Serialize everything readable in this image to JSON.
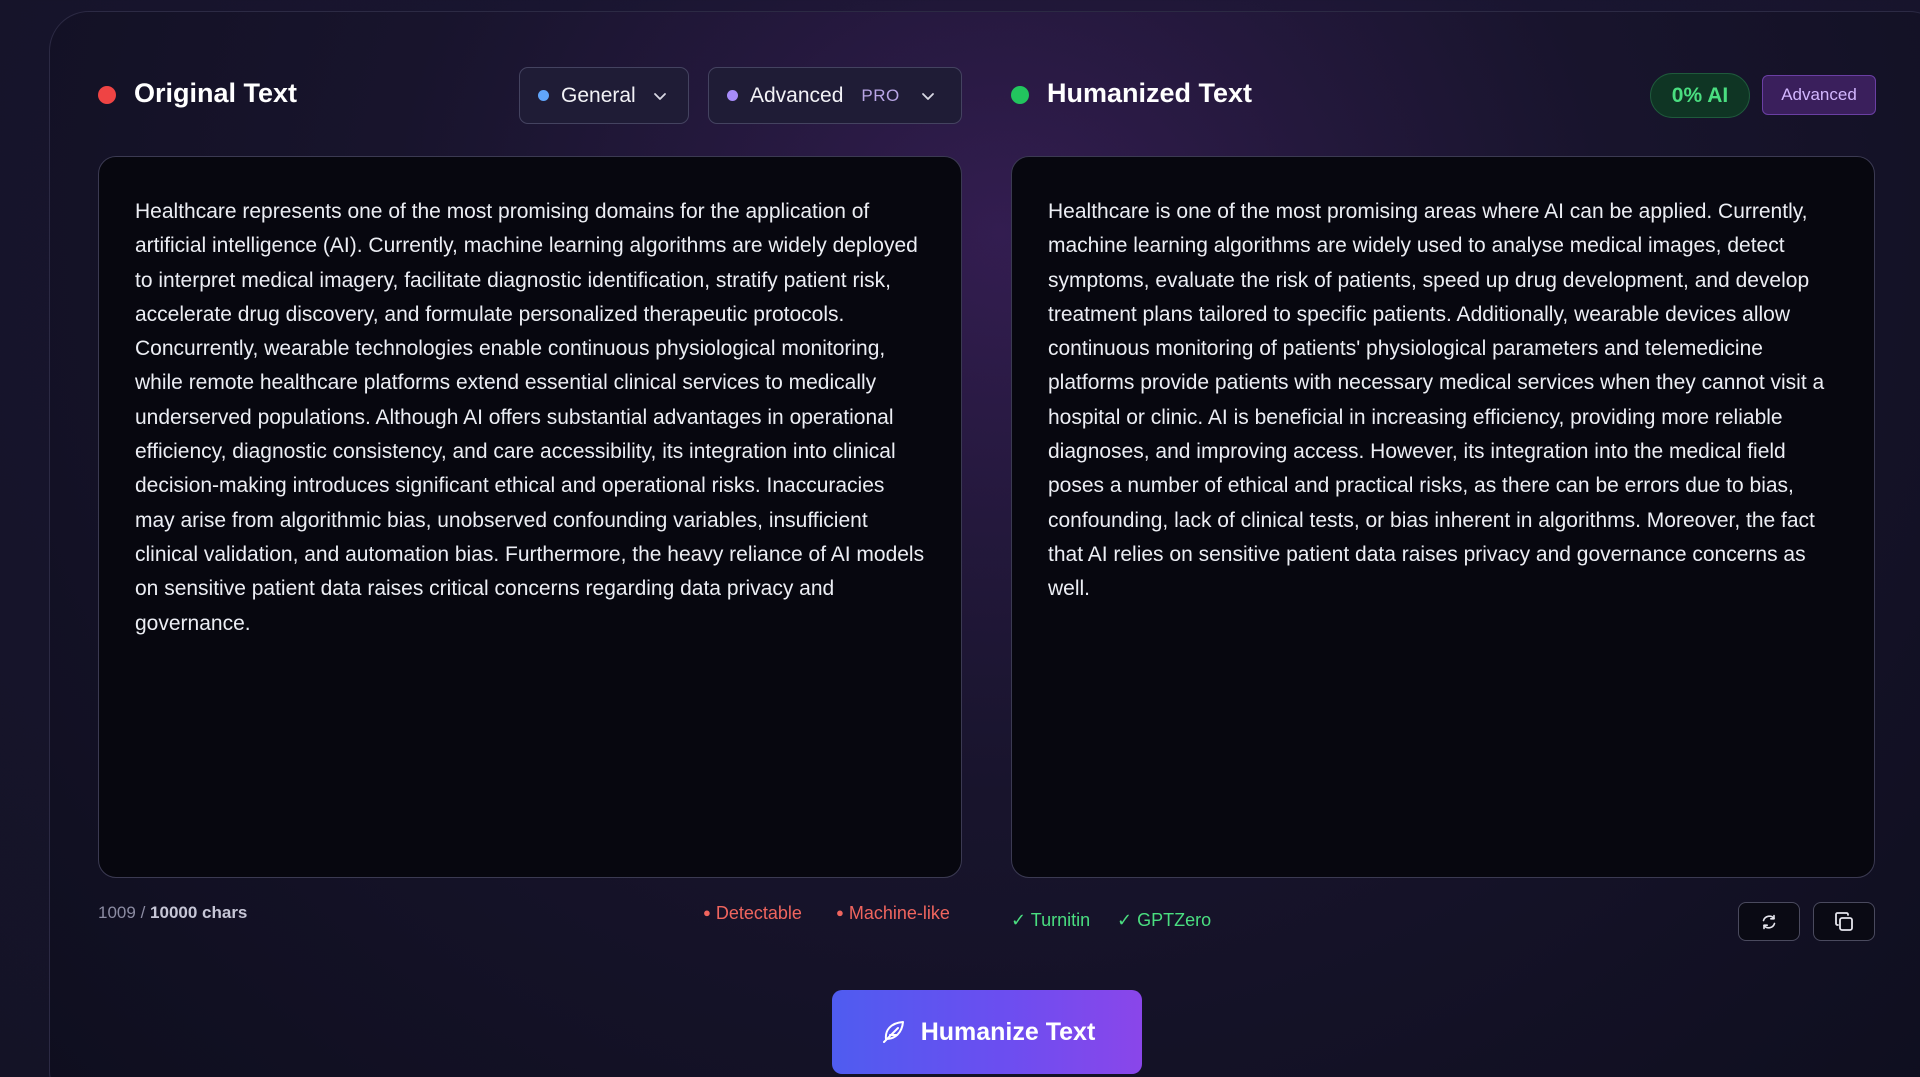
{
  "left_panel": {
    "title": "Original Text",
    "dot_color": "#ef4444",
    "mode_dropdown": {
      "label": "General",
      "dot_color": "#60a5fa"
    },
    "level_dropdown": {
      "label": "Advanced",
      "tag": "PRO",
      "dot_color": "#a78bfa"
    },
    "text": "Healthcare represents one of the most promising domains for the application of artificial intelligence (AI). Currently, machine learning algorithms are widely deployed to interpret medical imagery, facilitate diagnostic identification, stratify patient risk, accelerate drug discovery, and formulate personalized therapeutic protocols. Concurrently, wearable technologies enable continuous physiological monitoring, while remote healthcare platforms extend essential clinical services to medically underserved populations. Although AI offers substantial advantages in operational efficiency, diagnostic consistency, and care accessibility, its integration into clinical decision-making introduces significant ethical and operational risks. Inaccuracies may arise from algorithmic bias, unobserved confounding variables, insufficient clinical validation, and automation bias. Furthermore, the heavy reliance of AI models on sensitive patient data raises critical concerns regarding data privacy and governance.",
    "char_count": "1009",
    "char_separator": "/",
    "char_limit": "10000 chars",
    "flags": [
      "Detectable",
      "Machine-like"
    ]
  },
  "right_panel": {
    "title": "Humanized Text",
    "dot_color": "#22c55e",
    "ai_score_badge": "0% AI",
    "mode_badge": "Advanced",
    "text": "Healthcare is one of the most promising areas where AI can be applied. Currently, machine learning algorithms are widely used to analyse medical images, detect symptoms, evaluate the risk of patients, speed up drug development, and develop treatment plans tailored to specific patients. Additionally, wearable devices allow continuous monitoring of patients' physiological parameters and telemedicine platforms provide patients with necessary medical services when they cannot visit a hospital or clinic. AI is beneficial in increasing efficiency, providing more reliable diagnoses, and improving access. However, its integration into the medical field poses a number of ethical and practical risks, as there can be errors due to bias, confounding, lack of clinical tests, or bias inherent in algorithms. Moreover, the fact that AI relies on sensitive patient data raises privacy and governance concerns as well.",
    "checks": [
      "✓ Turnitin",
      "✓ GPTZero"
    ]
  },
  "actions": {
    "refresh_icon": "refresh-icon",
    "copy_icon": "copy-icon",
    "humanize_label": "Humanize Text",
    "humanize_icon": "feather-icon"
  },
  "colors": {
    "flag": "#f0655e",
    "check": "#4ade80",
    "accent_start": "#4f5cf0",
    "accent_end": "#8a46ea"
  }
}
